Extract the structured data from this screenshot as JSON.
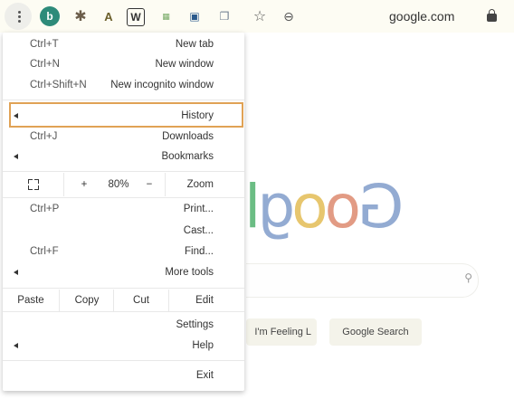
{
  "toolbar": {
    "profile_initial": "b",
    "url": "google.com",
    "extensions": [
      {
        "icon": "puzzle-icon"
      },
      {
        "icon": "a-extension-icon",
        "glyph": "A"
      },
      {
        "icon": "w-extension-icon",
        "glyph": "W"
      },
      {
        "icon": "grid-extension-icon",
        "glyph": "▦"
      },
      {
        "icon": "lock-extension-icon",
        "glyph": "🔒"
      },
      {
        "icon": "tag-extension-icon",
        "glyph": "❐"
      }
    ]
  },
  "page": {
    "logo_letters": [
      "G",
      "o",
      "o",
      "g",
      "l"
    ],
    "buttons": {
      "search": "Google Search",
      "lucky": "I'm Feeling L"
    }
  },
  "menu": {
    "new_tab": {
      "label": "New tab",
      "accel": "Ctrl+T"
    },
    "new_window": {
      "label": "New window",
      "accel": "Ctrl+N"
    },
    "new_incognito": {
      "label": "New incognito window",
      "accel": "Ctrl+Shift+N"
    },
    "history": {
      "label": "History"
    },
    "downloads": {
      "label": "Downloads",
      "accel": "Ctrl+J"
    },
    "bookmarks": {
      "label": "Bookmarks"
    },
    "zoom": {
      "label": "Zoom",
      "minus": "−",
      "level": "80%",
      "plus": "+"
    },
    "print": {
      "label": "Print...",
      "accel": "Ctrl+P"
    },
    "cast": {
      "label": "Cast..."
    },
    "find": {
      "label": "Find...",
      "accel": "Ctrl+F"
    },
    "more_tools": {
      "label": "More tools"
    },
    "edit": {
      "label": "Edit",
      "cut": "Cut",
      "copy": "Copy",
      "paste": "Paste"
    },
    "settings": {
      "label": "Settings"
    },
    "help": {
      "label": "Help"
    },
    "exit": {
      "label": "Exit"
    }
  },
  "colors": {
    "highlight_border": "#e0a255",
    "profile_bg": "#2e8b7a",
    "toolbar_bg": "#fdfcf3"
  }
}
